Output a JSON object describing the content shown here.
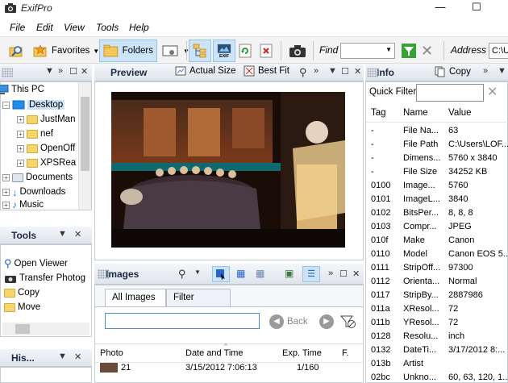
{
  "window": {
    "title": "ExifPro",
    "minimize": "—",
    "maximize": "☐"
  },
  "menu": [
    "File",
    "Edit",
    "View",
    "Tools",
    "Help"
  ],
  "toolbar": {
    "favorites": "Favorites",
    "folders": "Folders",
    "find_label": "Find",
    "address_label": "Address",
    "address_value": "C:\\U"
  },
  "folders_panel": {
    "items": [
      {
        "label": "This PC",
        "level": 0,
        "expander": ""
      },
      {
        "label": "Desktop",
        "level": 1,
        "expander": "−",
        "selected": true
      },
      {
        "label": "JustMan",
        "level": 2,
        "expander": "+"
      },
      {
        "label": "nef",
        "level": 2,
        "expander": "+"
      },
      {
        "label": "OpenOff",
        "level": 2,
        "expander": "+"
      },
      {
        "label": "XPSRea",
        "level": 2,
        "expander": "+"
      },
      {
        "label": "Documents",
        "level": 1,
        "expander": "+"
      },
      {
        "label": "Downloads",
        "level": 1,
        "expander": "+"
      },
      {
        "label": "Music",
        "level": 1,
        "expander": "+"
      }
    ]
  },
  "tools_panel": {
    "title": "Tools",
    "items": [
      "Open Viewer",
      "Transfer Photog",
      "Copy",
      "Move"
    ]
  },
  "history_panel": {
    "title": "His..."
  },
  "preview_panel": {
    "title": "Preview",
    "actual_size": "Actual Size",
    "best_fit": "Best Fit"
  },
  "images_panel": {
    "title": "Images",
    "tabs": [
      "All Images",
      "Filter Images"
    ],
    "back_label": "Back",
    "columns": [
      "Photo",
      "Date and Time",
      "Exp. Time",
      "F."
    ],
    "row": {
      "photo": "21",
      "date": "3/15/2012 7:06:13",
      "exp": "1/160"
    }
  },
  "info_panel": {
    "title": "Info",
    "copy": "Copy",
    "quick_filter": "Quick Filter",
    "columns": [
      "Tag",
      "Name",
      "Value"
    ],
    "rows": [
      [
        "-",
        "File Na...",
        "63"
      ],
      [
        "-",
        "File Path",
        "C:\\Users\\LOF..."
      ],
      [
        "-",
        "Dimens...",
        "5760 x 3840"
      ],
      [
        "-",
        "File Size",
        "34252 KB"
      ],
      [
        "0100",
        "Image...",
        "5760"
      ],
      [
        "0101",
        "ImageL...",
        "3840"
      ],
      [
        "0102",
        "BitsPer...",
        "8, 8, 8"
      ],
      [
        "0103",
        "Compr...",
        "JPEG"
      ],
      [
        "010f",
        "Make",
        "Canon"
      ],
      [
        "0110",
        "Model",
        "Canon EOS 5..."
      ],
      [
        "0111",
        "StripOff...",
        "97300"
      ],
      [
        "0112",
        "Orienta...",
        "Normal"
      ],
      [
        "0117",
        "StripBy...",
        "2887986"
      ],
      [
        "011a",
        "XResol...",
        "72"
      ],
      [
        "011b",
        "YResol...",
        "72"
      ],
      [
        "0128",
        "Resolu...",
        "inch"
      ],
      [
        "0132",
        "DateTi...",
        "3/17/2012 8:..."
      ],
      [
        "013b",
        "Artist",
        ""
      ],
      [
        "02bc",
        "Unkno...",
        "60, 63, 120, 1..."
      ]
    ]
  }
}
